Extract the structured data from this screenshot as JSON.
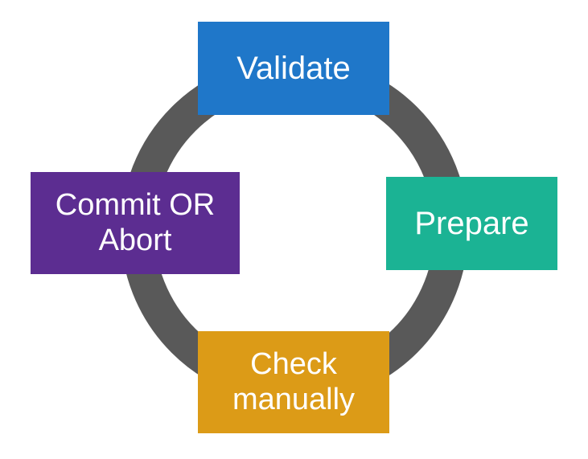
{
  "cycle": {
    "steps": [
      {
        "id": "validate",
        "label": "Validate",
        "color": "#1f77c9"
      },
      {
        "id": "prepare",
        "label": "Prepare",
        "color": "#1bb394"
      },
      {
        "id": "check",
        "label": "Check\nmanually",
        "color": "#dc9b17"
      },
      {
        "id": "commit",
        "label": "Commit OR\nAbort",
        "color": "#5c2d91"
      }
    ],
    "direction": "clockwise",
    "arrow_color": "#595959"
  }
}
